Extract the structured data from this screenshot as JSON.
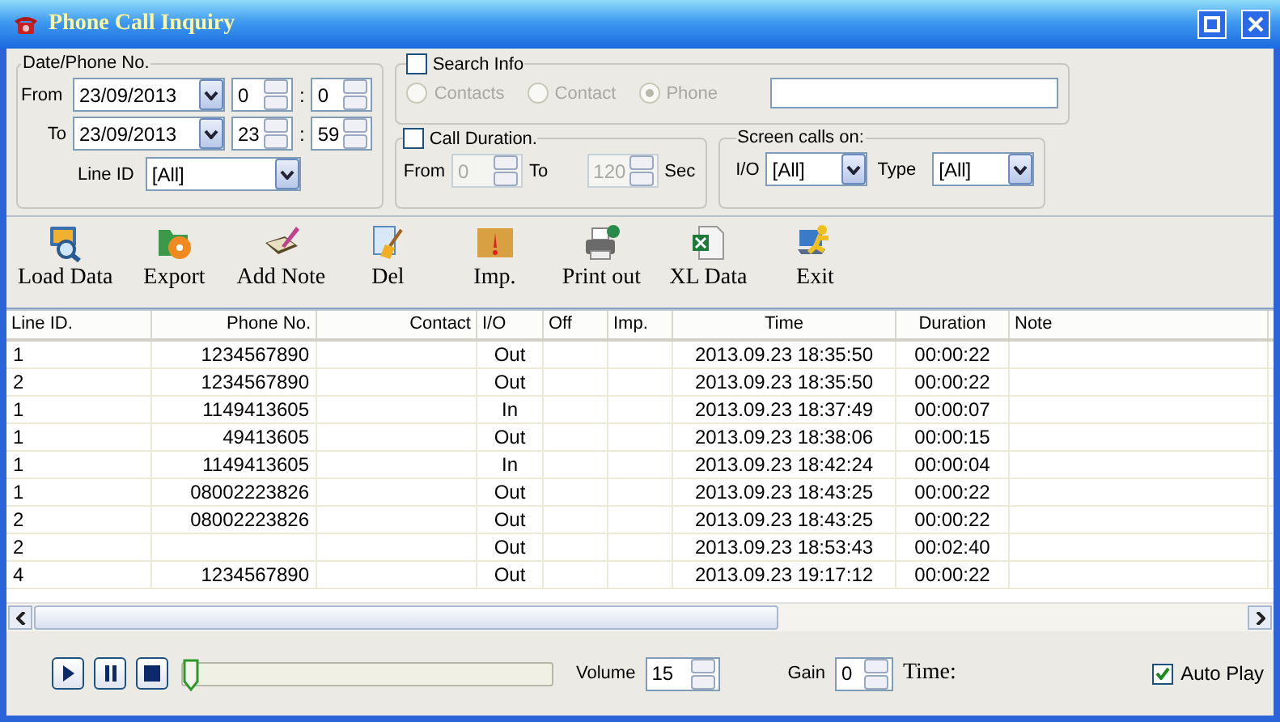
{
  "window": {
    "title": "Phone Call Inquiry"
  },
  "date_group": {
    "legend": "Date/Phone No.",
    "from_label": "From",
    "from_date": "23/09/2013",
    "from_hour": "0",
    "from_minute": "0",
    "to_label": "To",
    "to_date": "23/09/2013",
    "to_hour": "23",
    "to_minute": "59",
    "separator": ":",
    "line_id_label": "Line ID",
    "line_id": "[All]"
  },
  "search_info": {
    "label": "Search Info",
    "checked": false,
    "radios": [
      {
        "label": "Contacts",
        "selected": false,
        "disabled": true
      },
      {
        "label": "Contact",
        "selected": false,
        "disabled": true
      },
      {
        "label": "Phone",
        "selected": true,
        "disabled": true
      }
    ]
  },
  "call_duration": {
    "label": "Call Duration.",
    "checked": false,
    "from_label": "From",
    "from": "0",
    "to_label": "To",
    "to": "120",
    "unit": "Sec",
    "disabled": true
  },
  "screen_calls": {
    "legend": "Screen calls on:",
    "io_label": "I/O",
    "io": "[All]",
    "type_label": "Type",
    "type": "[All]"
  },
  "toolbar": [
    "Load Data",
    "Export",
    "Add Note",
    "Del",
    "Imp.",
    "Print out",
    "XL Data",
    "Exit"
  ],
  "table": {
    "columns": [
      "Line ID.",
      "Phone No.",
      "Contact",
      "I/O",
      "Off",
      "Imp.",
      "Time",
      "Duration",
      "Note"
    ],
    "rows": [
      {
        "line_id": "1",
        "phone_no": "1234567890",
        "io": "Out",
        "time": "2013.09.23 18:35:50",
        "duration": "00:00:22"
      },
      {
        "line_id": "2",
        "phone_no": "1234567890",
        "io": "Out",
        "time": "2013.09.23 18:35:50",
        "duration": "00:00:22"
      },
      {
        "line_id": "1",
        "phone_no": "1149413605",
        "io": "In",
        "time": "2013.09.23 18:37:49",
        "duration": "00:00:07"
      },
      {
        "line_id": "1",
        "phone_no": "49413605",
        "io": "Out",
        "time": "2013.09.23 18:38:06",
        "duration": "00:00:15"
      },
      {
        "line_id": "1",
        "phone_no": "1149413605",
        "io": "In",
        "time": "2013.09.23 18:42:24",
        "duration": "00:00:04"
      },
      {
        "line_id": "1",
        "phone_no": "08002223826",
        "io": "Out",
        "time": "2013.09.23 18:43:25",
        "duration": "00:00:22"
      },
      {
        "line_id": "2",
        "phone_no": "08002223826",
        "io": "Out",
        "time": "2013.09.23 18:43:25",
        "duration": "00:00:22"
      },
      {
        "line_id": "2",
        "io": "Out",
        "time": "2013.09.23 18:53:43",
        "duration": "00:02:40"
      },
      {
        "line_id": "4",
        "phone_no": "1234567890",
        "io": "Out",
        "time": "2013.09.23 19:17:12",
        "duration": "00:00:22"
      }
    ]
  },
  "player": {
    "position": {
      "level": 0
    },
    "volume_label": "Volume",
    "volume": "15",
    "gain_label": "Gain",
    "gain": "0",
    "time_label": "Time:",
    "auto_play": {
      "label": "Auto Play",
      "checked": true
    }
  }
}
